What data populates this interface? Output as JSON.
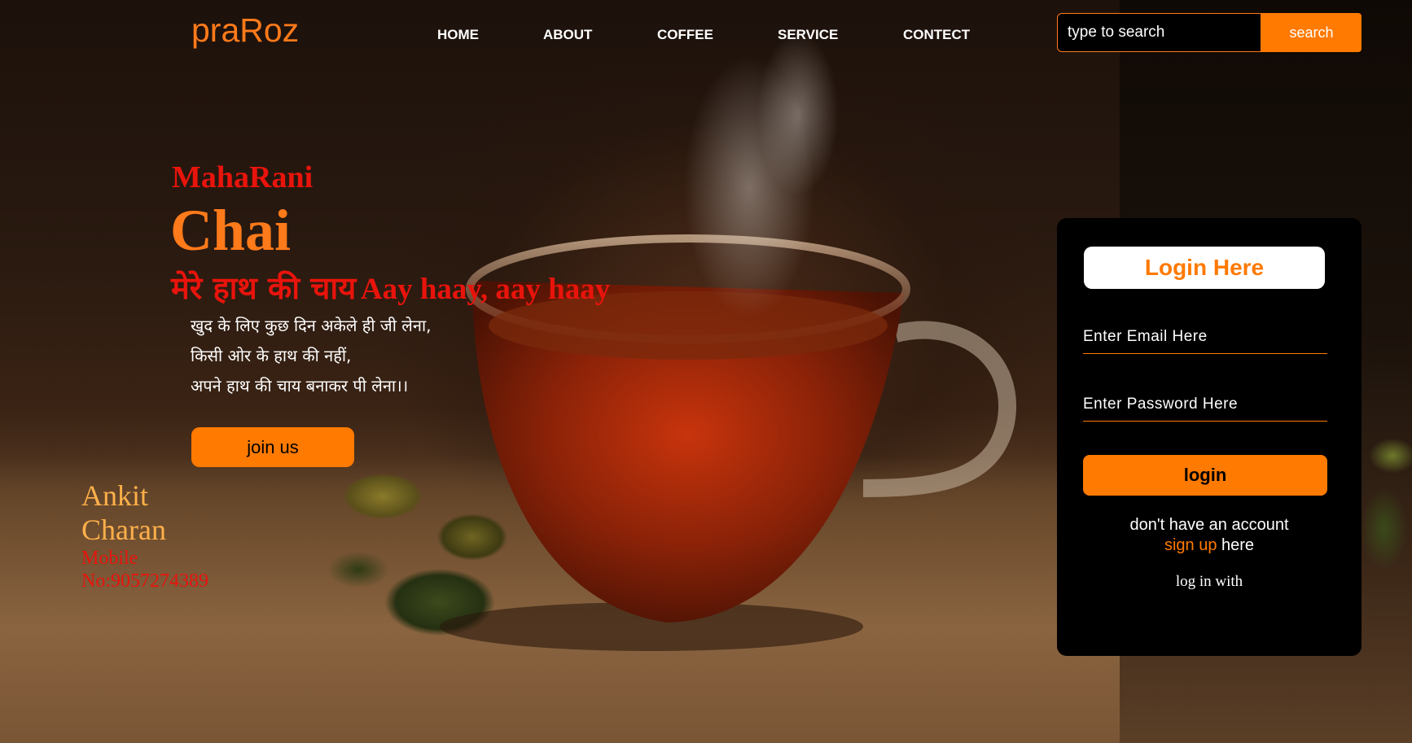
{
  "header": {
    "brand": "praRoz",
    "nav": [
      {
        "label": "HOME"
      },
      {
        "label": "ABOUT"
      },
      {
        "label": "COFFEE"
      },
      {
        "label": "SERVICE"
      },
      {
        "label": "CONTECT"
      }
    ],
    "search": {
      "placeholder": "type to search",
      "button_label": "search"
    }
  },
  "hero": {
    "subtitle": "MahaRani",
    "title": "Chai",
    "tagline_hindi": "मेरे हाथ की चाय",
    "tagline_latin": "Aay haay, aay haay",
    "poem": [
      "खुद के लिए कुछ दिन अकेले ही जी लेना,",
      "किसी ओर के हाथ की नहीं,",
      "अपने हाथ की चाय बनाकर पी लेना।।"
    ],
    "join_label": "join us",
    "author": {
      "first": "Ankit",
      "last": "Charan",
      "mobile_line1": "Mobile",
      "mobile_line2": "No:9057274389"
    }
  },
  "login": {
    "title": "Login Here",
    "email_placeholder": "Enter Email Here",
    "password_placeholder": "Enter Password Here",
    "button_label": "login",
    "no_account": "don't have an account",
    "signup_link": "sign up",
    "signup_suffix": " here",
    "login_with": "log in with"
  },
  "colors": {
    "accent": "#ff7a00",
    "red": "#e8140c",
    "card_bg": "#000000"
  }
}
